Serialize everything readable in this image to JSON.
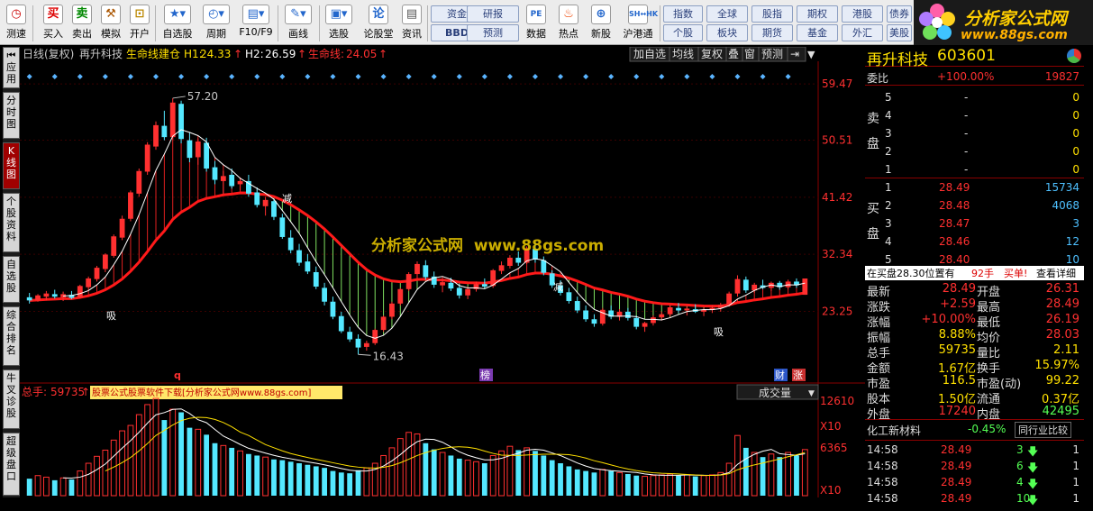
{
  "toolbar": {
    "items": [
      "测速",
      "买入",
      "卖出",
      "模拟",
      "开户",
      "自选股",
      "周期",
      "F10/F9",
      "画线",
      "选股",
      "论股堂",
      "资讯",
      "数据",
      "热点",
      "新股",
      "沪港通"
    ],
    "buttons_row1": [
      "资金",
      "研报",
      "指数",
      "全球",
      "股指",
      "期权",
      "港股",
      "债券"
    ],
    "buttons_row2": [
      "BBD",
      "预测",
      "个股",
      "板块",
      "期货",
      "基金",
      "外汇",
      "美股"
    ]
  },
  "logo": {
    "title": "分析家公式网",
    "url": "www.88gs.com"
  },
  "side_tabs": [
    "应用",
    "分时图",
    "K线图",
    "个股资料",
    "自选股",
    "综合排名",
    "牛叉诊股",
    "超级盘口"
  ],
  "chart": {
    "title_bar": {
      "period": "日线(复权)",
      "stock": "再升科技",
      "indicator": "生命线建仓",
      "h1_label": "H1:",
      "h1_value": "24.33",
      "h2_label": "H2:",
      "h2_value": "26.59",
      "life_label": "生命线:",
      "life_value": "24.05"
    },
    "buttons": [
      "加自选",
      "均线",
      "复权",
      "叠",
      "窗",
      "预测"
    ],
    "price_ticks": [
      "59.47",
      "50.51",
      "41.42",
      "32.34",
      "23.25"
    ],
    "high_label": "57.20",
    "low_label": "16.43",
    "watermark": "分析家公式网  www.88gs.com",
    "marks": {
      "q": "q",
      "bang": "榜",
      "cai": "财",
      "zhang": "涨",
      "xi1": "吸",
      "xi2": "吸",
      "jian": "减",
      "jian2": "减"
    },
    "volume_bar": {
      "label": "总手:",
      "value": "59735",
      "banner": "股票公式股票软件下载[分析家公式网www.88gs.com]",
      "select": "成交量"
    },
    "volume_ticks": [
      "12610",
      "X10",
      "6365",
      "X10"
    ],
    "colors": {
      "up": "#ff3030",
      "down": "#54e8ff",
      "life": "#ff1a1a",
      "ma": "#ffffff"
    }
  },
  "chart_data": {
    "type": "candlestick",
    "candles": [
      [
        25.5,
        26.2,
        24.5,
        25.0
      ],
      [
        25.0,
        26.0,
        24.8,
        25.8
      ],
      [
        25.6,
        26.5,
        25.0,
        26.1
      ],
      [
        26.0,
        26.7,
        25.3,
        25.6
      ],
      [
        25.5,
        26.4,
        24.9,
        26.0
      ],
      [
        25.9,
        26.5,
        25.2,
        25.4
      ],
      [
        25.5,
        27.5,
        25.3,
        27.3
      ],
      [
        27.1,
        28.8,
        26.6,
        28.5
      ],
      [
        28.4,
        30.5,
        28.0,
        30.2
      ],
      [
        30.0,
        32.5,
        29.5,
        32.3
      ],
      [
        32.1,
        35.5,
        31.8,
        35.2
      ],
      [
        35.0,
        38.5,
        34.6,
        38.0
      ],
      [
        38.0,
        42.5,
        37.6,
        42.2
      ],
      [
        42.0,
        46.0,
        41.5,
        45.6
      ],
      [
        45.5,
        50.2,
        45.0,
        49.8
      ],
      [
        49.5,
        53.5,
        49.0,
        52.9
      ],
      [
        52.8,
        55.2,
        50.5,
        51.0
      ],
      [
        51.0,
        57.2,
        50.6,
        56.5
      ],
      [
        56.3,
        56.8,
        50.0,
        50.7
      ],
      [
        50.5,
        51.8,
        47.0,
        47.7
      ],
      [
        47.8,
        50.8,
        46.6,
        50.3
      ],
      [
        50.1,
        50.9,
        45.5,
        46.0
      ],
      [
        46.2,
        47.2,
        43.5,
        44.2
      ],
      [
        44.0,
        45.6,
        42.0,
        44.8
      ],
      [
        45.0,
        46.0,
        42.8,
        43.2
      ],
      [
        43.5,
        44.6,
        42.5,
        44.0
      ],
      [
        44.0,
        45.0,
        41.5,
        42.0
      ],
      [
        42.2,
        43.0,
        39.8,
        40.2
      ],
      [
        40.0,
        41.5,
        38.5,
        41.0
      ],
      [
        40.8,
        41.2,
        37.8,
        38.3
      ],
      [
        38.2,
        38.8,
        34.8,
        35.1
      ],
      [
        35.0,
        36.2,
        32.5,
        33.0
      ],
      [
        33.0,
        34.0,
        30.5,
        31.0
      ],
      [
        31.2,
        32.4,
        29.2,
        29.6
      ],
      [
        29.5,
        30.4,
        26.8,
        27.2
      ],
      [
        27.0,
        27.8,
        24.2,
        24.8
      ],
      [
        24.8,
        25.6,
        22.0,
        22.4
      ],
      [
        22.5,
        23.2,
        19.8,
        20.1
      ],
      [
        20.0,
        20.8,
        18.4,
        18.8
      ],
      [
        18.9,
        19.6,
        16.4,
        17.5
      ],
      [
        17.6,
        18.6,
        17.0,
        18.2
      ],
      [
        18.2,
        20.5,
        17.9,
        20.3
      ],
      [
        20.3,
        22.6,
        20.0,
        22.4
      ],
      [
        22.4,
        24.8,
        22.0,
        24.5
      ],
      [
        24.5,
        27.0,
        24.2,
        26.8
      ],
      [
        26.8,
        29.5,
        26.5,
        29.2
      ],
      [
        29.2,
        31.2,
        28.5,
        30.8
      ],
      [
        30.6,
        31.4,
        28.3,
        28.7
      ],
      [
        28.8,
        29.6,
        27.0,
        27.5
      ],
      [
        27.4,
        28.4,
        26.3,
        27.9
      ],
      [
        27.8,
        28.6,
        26.5,
        26.9
      ],
      [
        27.0,
        27.6,
        25.3,
        25.8
      ],
      [
        25.8,
        27.2,
        25.2,
        26.8
      ],
      [
        26.8,
        28.0,
        26.4,
        27.6
      ],
      [
        27.6,
        28.5,
        26.9,
        27.2
      ],
      [
        27.3,
        30.0,
        27.0,
        29.8
      ],
      [
        29.7,
        31.2,
        29.2,
        30.6
      ],
      [
        30.5,
        32.2,
        30.1,
        31.8
      ],
      [
        31.8,
        32.8,
        30.5,
        31.0
      ],
      [
        31.0,
        33.6,
        30.8,
        33.3
      ],
      [
        33.2,
        34.2,
        31.0,
        31.5
      ],
      [
        31.4,
        32.0,
        29.0,
        29.4
      ],
      [
        29.3,
        29.8,
        27.0,
        27.4
      ],
      [
        27.4,
        28.2,
        25.8,
        26.2
      ],
      [
        26.3,
        27.0,
        24.5,
        24.9
      ],
      [
        24.9,
        25.6,
        23.0,
        23.4
      ],
      [
        23.4,
        24.2,
        21.6,
        22.0
      ],
      [
        22.0,
        22.8,
        20.8,
        21.3
      ],
      [
        21.3,
        23.8,
        21.0,
        23.5
      ],
      [
        23.4,
        24.2,
        22.0,
        22.4
      ],
      [
        22.4,
        23.6,
        21.8,
        23.2
      ],
      [
        23.2,
        23.8,
        21.8,
        22.2
      ],
      [
        22.2,
        22.6,
        20.4,
        20.8
      ],
      [
        20.8,
        21.6,
        20.0,
        21.4
      ],
      [
        21.4,
        22.6,
        21.0,
        22.3
      ],
      [
        22.3,
        23.2,
        21.8,
        22.8
      ],
      [
        22.8,
        24.2,
        22.4,
        23.9
      ],
      [
        23.8,
        24.6,
        23.0,
        23.4
      ],
      [
        23.4,
        24.0,
        22.6,
        23.7
      ],
      [
        23.6,
        24.4,
        23.0,
        23.2
      ],
      [
        23.2,
        23.8,
        22.5,
        23.5
      ],
      [
        23.5,
        24.2,
        23.0,
        23.8
      ],
      [
        23.8,
        24.6,
        23.2,
        24.3
      ],
      [
        24.3,
        26.4,
        24.0,
        26.1
      ],
      [
        26.1,
        29.0,
        25.6,
        28.4
      ],
      [
        28.3,
        28.8,
        26.2,
        26.6
      ],
      [
        26.6,
        27.8,
        26.2,
        27.5
      ],
      [
        27.4,
        28.3,
        26.8,
        27.0
      ],
      [
        27.0,
        28.0,
        26.5,
        27.8
      ],
      [
        27.8,
        28.1,
        26.7,
        27.1
      ],
      [
        27.1,
        28.3,
        26.8,
        28.0
      ],
      [
        28.0,
        28.5,
        27.0,
        27.4
      ],
      [
        25.9,
        28.49,
        25.9,
        28.49
      ]
    ],
    "volumes": [
      2200,
      2600,
      2400,
      2000,
      2300,
      2100,
      3200,
      4200,
      5100,
      5900,
      7200,
      8400,
      9100,
      10500,
      11800,
      12610,
      9800,
      11200,
      10800,
      8800,
      8600,
      7900,
      6800,
      6500,
      6200,
      5800,
      5400,
      5200,
      5000,
      4700,
      4600,
      4400,
      4200,
      4000,
      3800,
      3600,
      3200,
      3000,
      2900,
      3300,
      3600,
      4200,
      5200,
      6200,
      7400,
      8200,
      8000,
      6800,
      6000,
      5600,
      5200,
      4800,
      4600,
      4400,
      4200,
      5200,
      5800,
      6400,
      5900,
      6200,
      5800,
      5200,
      4600,
      4200,
      3800,
      3400,
      3200,
      3000,
      3400,
      3200,
      3000,
      2800,
      2600,
      2500,
      2600,
      2700,
      2800,
      2600,
      2700,
      2500,
      2600,
      2700,
      3000,
      4200,
      7800,
      6200,
      5600,
      5000,
      5400,
      5000,
      5600,
      5200,
      5974
    ]
  },
  "quote": {
    "name": "再升科技",
    "code": "603601",
    "wb_label": "委比",
    "wb_pct": "+100.00%",
    "wb_val": "19827",
    "sell_label": "卖盘",
    "sell": [
      [
        "5",
        "-",
        "0"
      ],
      [
        "4",
        "-",
        "0"
      ],
      [
        "3",
        "-",
        "0"
      ],
      [
        "2",
        "-",
        "0"
      ],
      [
        "1",
        "-",
        "0"
      ]
    ],
    "buy_label": "买盘",
    "buy": [
      [
        "1",
        "28.49",
        "15734"
      ],
      [
        "2",
        "28.48",
        "4068"
      ],
      [
        "3",
        "28.47",
        "3"
      ],
      [
        "4",
        "28.46",
        "12"
      ],
      [
        "5",
        "28.40",
        "10"
      ]
    ],
    "info_line": {
      "text": "在买盘28.30位置有",
      "vol": "92手",
      "action": "买单!",
      "detail": "查看详细"
    },
    "stats": [
      [
        "最新",
        "28.49",
        "开盘",
        "26.31"
      ],
      [
        "涨跌",
        "+2.59",
        "最高",
        "28.49"
      ],
      [
        "涨幅",
        "+10.00%",
        "最低",
        "26.19"
      ],
      [
        "振幅",
        "8.88%",
        "均价",
        "28.03"
      ],
      [
        "总手",
        "59735",
        "量比",
        "2.11"
      ],
      [
        "金额",
        "1.67亿",
        "换手",
        "15.97%"
      ],
      [
        "市盈",
        "116.5",
        "市盈(动)",
        "99.22"
      ],
      [
        "股本",
        "1.50亿",
        "流通",
        "0.37亿"
      ],
      [
        "外盘",
        "17240",
        "内盘",
        "42495"
      ]
    ],
    "industry": {
      "name": "化工新材料",
      "pct": "-0.45%",
      "compare": "同行业比较"
    },
    "ticks": [
      [
        "14:58",
        "28.49",
        "3",
        "1"
      ],
      [
        "14:58",
        "28.49",
        "6",
        "1"
      ],
      [
        "14:58",
        "28.49",
        "4",
        "1"
      ],
      [
        "14:58",
        "28.49",
        "10",
        "1"
      ]
    ]
  }
}
